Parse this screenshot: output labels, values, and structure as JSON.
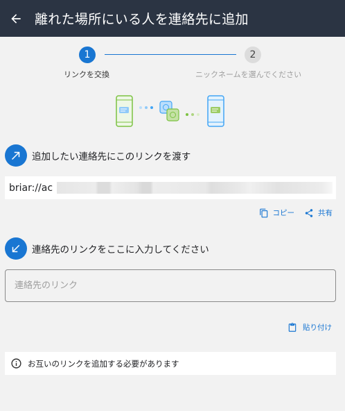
{
  "app_bar": {
    "title": "離れた場所にいる人を連絡先に追加"
  },
  "stepper": {
    "steps": [
      {
        "number": "1",
        "label": "リンクを交換",
        "active": true
      },
      {
        "number": "2",
        "label": "ニックネームを選んでください",
        "active": false
      }
    ]
  },
  "share_section": {
    "heading": "追加したい連絡先にこのリンクを渡す",
    "link_prefix": "briar://ac",
    "copy_label": "コピー",
    "share_label": "共有"
  },
  "receive_section": {
    "heading": "連絡先のリンクをここに入力してください",
    "input_placeholder": "連絡先のリンク",
    "input_value": "",
    "paste_label": "貼り付け"
  },
  "info": {
    "text": "お互いのリンクを追加する必要があります"
  },
  "colors": {
    "app_bar": "#2b3443",
    "accent": "#1976d2",
    "background": "#f2f2f2",
    "phone_green": "#7cc242",
    "phone_blue": "#42a5f5"
  },
  "icons": [
    "back-arrow-icon",
    "outgoing-arrow-icon",
    "incoming-arrow-icon",
    "copy-icon",
    "share-icon",
    "clipboard-icon",
    "info-icon"
  ]
}
